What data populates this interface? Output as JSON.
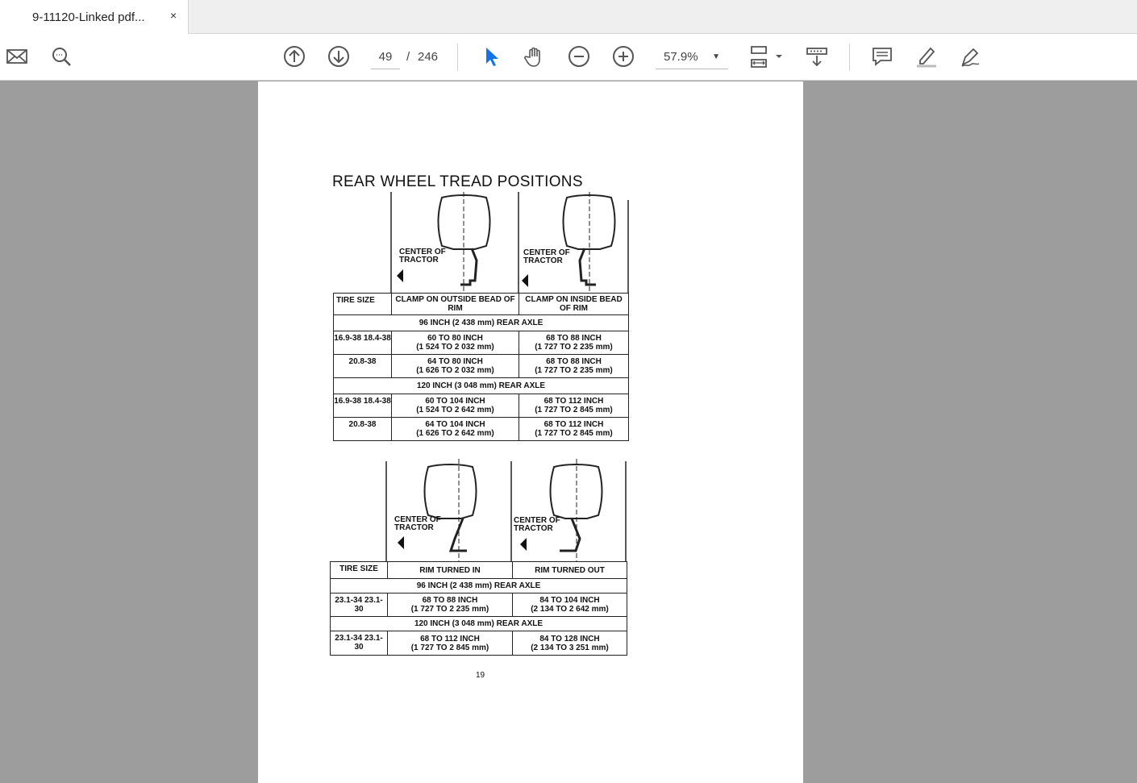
{
  "tab": {
    "title": "9-11120-Linked pdf...",
    "close": "×"
  },
  "toolbar": {
    "page_current": "49",
    "page_sep": "/",
    "page_total": "246",
    "zoom": "57.9%"
  },
  "document": {
    "title": "REAR WHEEL TREAD POSITIONS",
    "center_label_1": "CENTER OF",
    "center_label_2": "TRACTOR",
    "table1": {
      "headers": [
        "TIRE SIZE",
        "CLAMP ON OUTSIDE BEAD OF RIM",
        "CLAMP ON INSIDE BEAD OF RIM"
      ],
      "sections": [
        {
          "axle": "96 INCH (2 438 mm) REAR AXLE",
          "rows": [
            {
              "tire": "16.9-38 18.4-38",
              "a": "60 TO 80 INCH",
              "a_mm": "(1 524 TO 2 032 mm)",
              "b": "68 TO 88 INCH",
              "b_mm": "(1 727 TO 2 235 mm)"
            },
            {
              "tire": "20.8-38",
              "a": "64 TO 80 INCH",
              "a_mm": "(1 626 TO 2 032 mm)",
              "b": "68 TO 88 INCH",
              "b_mm": "(1 727 TO 2 235 mm)"
            }
          ]
        },
        {
          "axle": "120 INCH (3 048 mm) REAR AXLE",
          "rows": [
            {
              "tire": "16.9-38 18.4-38",
              "a": "60 TO 104 INCH",
              "a_mm": "(1 524 TO 2 642 mm)",
              "b": "68 TO 112 INCH",
              "b_mm": "(1 727 TO 2 845 mm)"
            },
            {
              "tire": "20.8-38",
              "a": "64 TO 104 INCH",
              "a_mm": "(1 626 TO 2 642 mm)",
              "b": "68 TO 112 INCH",
              "b_mm": "(1 727 TO 2 845 mm)"
            }
          ]
        }
      ]
    },
    "table2": {
      "headers": [
        "TIRE SIZE",
        "RIM TURNED IN",
        "RIM TURNED OUT"
      ],
      "sections": [
        {
          "axle": "96 INCH (2 438 mm) REAR AXLE",
          "rows": [
            {
              "tire": "23.1-34 23.1-30",
              "a": "68 TO 88 INCH",
              "a_mm": "(1 727 TO 2 235 mm)",
              "b": "84 TO 104 INCH",
              "b_mm": "(2 134 TO 2 642 mm)"
            }
          ]
        },
        {
          "axle": "120 INCH (3 048 mm) REAR AXLE",
          "rows": [
            {
              "tire": "23.1-34 23.1-30",
              "a": "68 TO 112 INCH",
              "a_mm": "(1 727 TO 2 845 mm)",
              "b": "84 TO 128 INCH",
              "b_mm": "(2 134 TO 3 251 mm)"
            }
          ]
        }
      ]
    },
    "page_number": "19"
  }
}
